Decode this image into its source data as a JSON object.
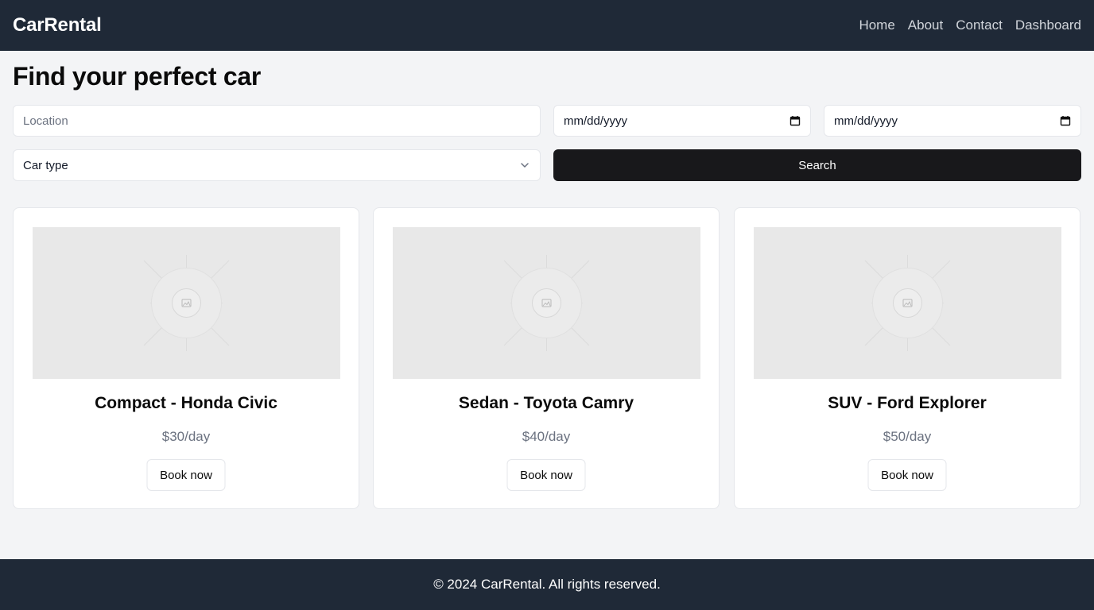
{
  "header": {
    "brand": "CarRental",
    "nav": [
      "Home",
      "About",
      "Contact",
      "Dashboard"
    ]
  },
  "main": {
    "title": "Find your perfect car",
    "search": {
      "location_placeholder": "Location",
      "pickup_date": "mm/dd/yyyy",
      "return_date": "mm/dd/yyyy",
      "car_type": "Car type",
      "search_label": "Search"
    },
    "cars": [
      {
        "title": "Compact - Honda Civic",
        "price": "$30/day",
        "action": "Book now"
      },
      {
        "title": "Sedan - Toyota Camry",
        "price": "$40/day",
        "action": "Book now"
      },
      {
        "title": "SUV - Ford Explorer",
        "price": "$50/day",
        "action": "Book now"
      }
    ]
  },
  "footer": {
    "text": "© 2024 CarRental. All rights reserved."
  },
  "colors": {
    "nav_bg": "#1f2937",
    "page_bg": "#f3f4f6",
    "primary_button": "#18181b",
    "muted_text": "#6b7280"
  },
  "icons": [
    "calendar-icon",
    "chevron-down-icon",
    "image-placeholder-icon"
  ]
}
